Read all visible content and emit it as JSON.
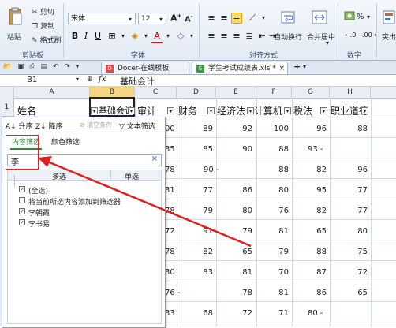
{
  "ribbon": {
    "paste_label": "粘贴",
    "cut_label": "剪切",
    "copy_label": "复制",
    "format_painter_label": "格式刷",
    "font_name": "宋体",
    "font_size": "12",
    "clipboard_group": "剪贴板",
    "font_group": "字体",
    "align_group": "对齐方式",
    "number_group": "数字",
    "wrap_label": "自动换行",
    "merge_label": "合并居中",
    "percent_label": "%",
    "other_label": "突出"
  },
  "tabs": {
    "docer_label": "Docer-在线模板",
    "file_label": "学生考试成绩表.xls *",
    "add_label": "+"
  },
  "formula_bar": {
    "cell_ref": "B1",
    "fx_label": "fx",
    "value": "基础会计"
  },
  "columns": [
    "A",
    "B",
    "C",
    "D",
    "E",
    "F",
    "G",
    "H"
  ],
  "headers": {
    "name": "姓名",
    "b": "基础会计",
    "c": "审计",
    "d": "财务",
    "e": "经济法",
    "f": "计算机",
    "g": "税法",
    "h": "职业道德"
  },
  "row1_label": "1",
  "rows": [
    {
      "c": "00",
      "d": "89",
      "e": "92",
      "f": "100",
      "g": "96",
      "h": "88"
    },
    {
      "c": "35",
      "d": "85",
      "e": "90",
      "f": "88",
      "g": "93 -",
      "h": ""
    },
    {
      "c": "78",
      "d": "90 -",
      "e": "",
      "f": "88",
      "g": "82",
      "h": "96"
    },
    {
      "c": "31",
      "d": "77",
      "e": "86",
      "f": "80",
      "g": "95",
      "h": "77"
    },
    {
      "c": "78",
      "d": "79",
      "e": "80",
      "f": "76",
      "g": "82",
      "h": "77"
    },
    {
      "c": "72",
      "d": "91",
      "e": "79",
      "f": "81",
      "g": "65",
      "h": "80"
    },
    {
      "c": "78",
      "d": "82",
      "e": "65",
      "f": "79",
      "g": "88",
      "h": "75"
    },
    {
      "c": "30",
      "d": "83",
      "e": "81",
      "f": "70",
      "g": "87",
      "h": "72"
    },
    {
      "c": "76 -",
      "d": "",
      "e": "78",
      "f": "81",
      "g": "86",
      "h": "65"
    },
    {
      "c": "33",
      "d": "68",
      "e": "72",
      "f": "71",
      "g": "80 -",
      "h": ""
    }
  ],
  "filter": {
    "sort_asc": "升序",
    "sort_desc": "降序",
    "clear": "清空条件",
    "text_filter": "文本筛选",
    "tab_content": "内容筛选",
    "tab_color": "颜色筛选",
    "search_value": "李",
    "col_multi": "多选",
    "col_single": "单选",
    "items": [
      {
        "label": "(全选)",
        "checked": true
      },
      {
        "label": "将当前所选内容添加到筛选器",
        "checked": false
      },
      {
        "label": "李朝霞",
        "checked": true
      },
      {
        "label": "李书易",
        "checked": true
      }
    ]
  },
  "colors": {
    "annotation_red": "#e02020",
    "tab_highlight": "#2e8b3a"
  }
}
